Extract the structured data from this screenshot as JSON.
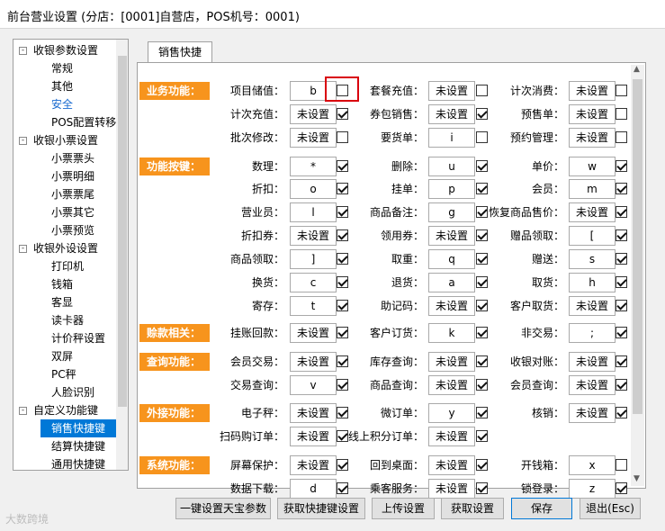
{
  "window": {
    "title": "前台营业设置 (分店：[0001]自营店，POS机号：0001)"
  },
  "sidebar": {
    "items": [
      {
        "label": "收银参数设置",
        "level": 0
      },
      {
        "label": "常规",
        "level": 1
      },
      {
        "label": "其他",
        "level": 1
      },
      {
        "label": "安全",
        "level": 1
      },
      {
        "label": "POS配置转移",
        "level": 1
      },
      {
        "label": "收银小票设置",
        "level": 0
      },
      {
        "label": "小票票头",
        "level": 1
      },
      {
        "label": "小票明细",
        "level": 1
      },
      {
        "label": "小票票尾",
        "level": 1
      },
      {
        "label": "小票其它",
        "level": 1
      },
      {
        "label": "小票预览",
        "level": 1
      },
      {
        "label": "收银外设设置",
        "level": 0
      },
      {
        "label": "打印机",
        "level": 1
      },
      {
        "label": "钱箱",
        "level": 1
      },
      {
        "label": "客显",
        "level": 1
      },
      {
        "label": "读卡器",
        "level": 1
      },
      {
        "label": "计价秤设置",
        "level": 1
      },
      {
        "label": "双屏",
        "level": 1
      },
      {
        "label": "PC秤",
        "level": 1
      },
      {
        "label": "人脸识别",
        "level": 1
      },
      {
        "label": "自定义功能键",
        "level": 0
      },
      {
        "label": "销售快捷键",
        "level": 1
      },
      {
        "label": "结算快捷键",
        "level": 1
      },
      {
        "label": "通用快捷键",
        "level": 1
      }
    ],
    "expander": "-"
  },
  "tab": {
    "label": "销售快捷"
  },
  "sections": [
    "业务功能：",
    "功能按键：",
    "赊款相关：",
    "查询功能：",
    "外接功能：",
    "系统功能："
  ],
  "fields": [
    {
      "label": "项目储值：",
      "value": "b",
      "checked": false
    },
    {
      "label": "套餐充值：",
      "value": "未设置",
      "checked": false
    },
    {
      "label": "计次消费：",
      "value": "未设置",
      "checked": false
    },
    {
      "label": "计次充值：",
      "value": "未设置",
      "checked": true
    },
    {
      "label": "券包销售：",
      "value": "未设置",
      "checked": true
    },
    {
      "label": "预售单：",
      "value": "未设置",
      "checked": false
    },
    {
      "label": "批次修改：",
      "value": "未设置",
      "checked": false
    },
    {
      "label": "要货单：",
      "value": "i",
      "checked": false
    },
    {
      "label": "预约管理：",
      "value": "未设置",
      "checked": false
    },
    {
      "label": "数理：",
      "value": "*",
      "checked": true
    },
    {
      "label": "删除：",
      "value": "u",
      "checked": true
    },
    {
      "label": "单价：",
      "value": "w",
      "checked": true
    },
    {
      "label": "折扣：",
      "value": "o",
      "checked": true
    },
    {
      "label": "挂单：",
      "value": "p",
      "checked": true
    },
    {
      "label": "会员：",
      "value": "m",
      "checked": true
    },
    {
      "label": "营业员：",
      "value": "l",
      "checked": true
    },
    {
      "label": "商品备注：",
      "value": "g",
      "checked": true
    },
    {
      "label": "恢复商品售价：",
      "value": "未设置",
      "checked": true
    },
    {
      "label": "折扣券：",
      "value": "未设置",
      "checked": true
    },
    {
      "label": "领用券：",
      "value": "未设置",
      "checked": true
    },
    {
      "label": "赠品领取：",
      "value": "[",
      "checked": true
    },
    {
      "label": "商品领取：",
      "value": "]",
      "checked": true
    },
    {
      "label": "取重：",
      "value": "q",
      "checked": true
    },
    {
      "label": "赠送：",
      "value": "s",
      "checked": true
    },
    {
      "label": "换货：",
      "value": "c",
      "checked": true
    },
    {
      "label": "退货：",
      "value": "a",
      "checked": true
    },
    {
      "label": "取货：",
      "value": "h",
      "checked": true
    },
    {
      "label": "寄存：",
      "value": "t",
      "checked": true
    },
    {
      "label": "助记码：",
      "value": "未设置",
      "checked": true
    },
    {
      "label": "客户取货：",
      "value": "未设置",
      "checked": true
    },
    {
      "label": "挂账回款：",
      "value": "未设置",
      "checked": true
    },
    {
      "label": "客户订货：",
      "value": "k",
      "checked": true
    },
    {
      "label": "非交易：",
      "value": ";",
      "checked": true
    },
    {
      "label": "会员交易：",
      "value": "未设置",
      "checked": true
    },
    {
      "label": "库存查询：",
      "value": "未设置",
      "checked": true
    },
    {
      "label": "收银对账：",
      "value": "未设置",
      "checked": true
    },
    {
      "label": "交易查询：",
      "value": "v",
      "checked": true
    },
    {
      "label": "商品查询：",
      "value": "未设置",
      "checked": true
    },
    {
      "label": "会员查询：",
      "value": "未设置",
      "checked": true
    },
    {
      "label": "电子秤：",
      "value": "未设置",
      "checked": true
    },
    {
      "label": "微订单：",
      "value": "y",
      "checked": true
    },
    {
      "label": "核销：",
      "value": "未设置",
      "checked": true
    },
    {
      "label": "扫码购订单：",
      "value": "未设置",
      "checked": true
    },
    {
      "label": "线上积分订单：",
      "value": "未设置",
      "checked": true
    },
    {
      "label": "屏幕保护：",
      "value": "未设置",
      "checked": true
    },
    {
      "label": "回到桌面：",
      "value": "未设置",
      "checked": true
    },
    {
      "label": "开钱箱：",
      "value": "x",
      "checked": false
    },
    {
      "label": "数据下载：",
      "value": "d",
      "checked": true
    },
    {
      "label": "乘客服务：",
      "value": "未设置",
      "checked": true
    },
    {
      "label": "锁登录：",
      "value": "z",
      "checked": true
    }
  ],
  "buttons": {
    "tianbao": "一键设置天宝参数",
    "get_shortcuts": "获取快捷键设置",
    "upload": "上传设置",
    "get_settings": "获取设置",
    "save": "保存",
    "exit": "退出(Esc)"
  },
  "scroll": {
    "up": "▲",
    "down": "▼"
  },
  "watermark": "大数跨境"
}
